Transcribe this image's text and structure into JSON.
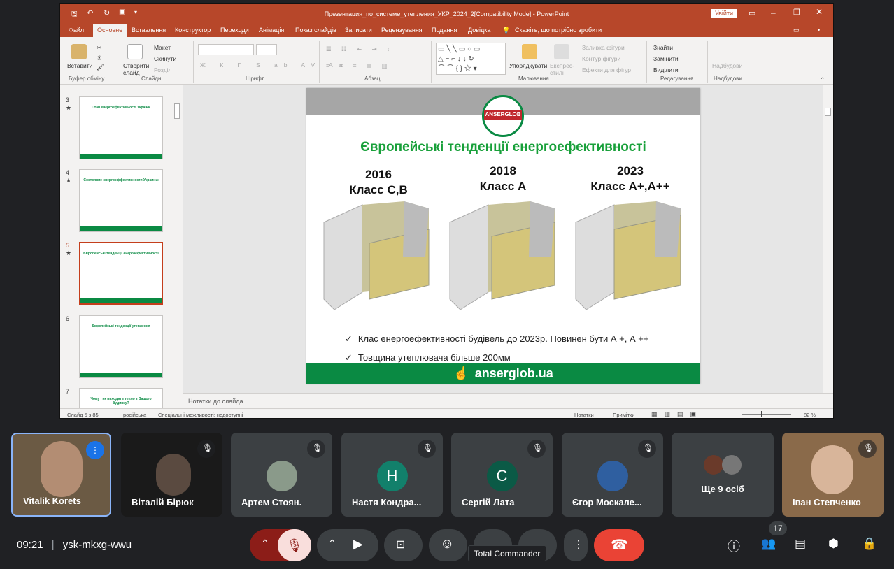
{
  "window": {
    "title": "Презентация_по_системе_утепления_УКР_2024_2[Compatibility Mode]  -  PowerPoint",
    "signin_label": "Увійти"
  },
  "ribbon_tabs": [
    "Файл",
    "Основне",
    "Вставлення",
    "Конструктор",
    "Переходи",
    "Анімація",
    "Показ слайдів",
    "Записати",
    "Рецензування",
    "Подання",
    "Довідка"
  ],
  "tell_me": "Скажіть, що потрібно зробити",
  "ribbon": {
    "paste": "Вставити",
    "clipboard": "Буфер обміну",
    "new_slide": "Створити слайд",
    "layout": "Макет",
    "reset": "Скинути",
    "section": "Розділ",
    "slides": "Слайди",
    "font": "Шрифт",
    "paragraph": "Абзац",
    "arrange": "Упорядкувати",
    "quick_styles": "Експрес-стилі",
    "shape_fill": "Заливка фігури",
    "shape_outline": "Контур фігури",
    "shape_effects": "Ефекти для фігур",
    "drawing": "Малювання",
    "find": "Знайти",
    "replace": "Замінити",
    "select": "Виділити",
    "editing": "Редагування",
    "addins": "Надбудови",
    "addins_group": "Надбудови",
    "font_buttons": [
      "Ж",
      "К",
      "П",
      "S",
      "ab",
      "AV",
      "Aa"
    ]
  },
  "thumbnails": [
    {
      "num": "3",
      "star": "★",
      "title": "Стан енергоефективності України"
    },
    {
      "num": "4",
      "star": "★",
      "title": "Состояние энергоэффективности Украины"
    },
    {
      "num": "5",
      "star": "★",
      "title": "Європейські тенденції енергоефективності"
    },
    {
      "num": "6",
      "star": "",
      "title": "Європейські тенденції утеплення"
    },
    {
      "num": "7",
      "star": "",
      "title": "Чому і як виходить тепло з Вашого будинку?"
    }
  ],
  "slide": {
    "logo": "ANSERGLOB",
    "title": "Європейські тенденції енергоефективності",
    "col1_year": "2016",
    "col1_class": "Класс С,В",
    "col2_year": "2018",
    "col2_class": "Класс А",
    "col3_year": "2023",
    "col3_class": "Класс А+,А++",
    "bullet1": "Клас енергоефективності будівель до 2023р. Повинен бути А +, А ++",
    "bullet2": "Товщина утеплювача більше 200мм",
    "check": "✓",
    "footer": "anserglob.ua"
  },
  "notes_placeholder": "Нотатки до слайда",
  "status": {
    "slide": "Слайд 5 з 85",
    "lang": "російська",
    "access": "Спеціальні можливості: недоступні",
    "notes": "Нотатки",
    "comments": "Примітки",
    "zoom": "82 %",
    "zoom_value": 82
  },
  "participants": [
    {
      "name": "Vitalik Korets",
      "kind": "video",
      "speaking": true
    },
    {
      "name": "Віталій Бірюк",
      "kind": "video"
    },
    {
      "name": "Артем Стоян.",
      "kind": "avatar-photo",
      "bg": "#8a9a8a"
    },
    {
      "name": "Настя Кондра...",
      "kind": "avatar",
      "letter": "Н",
      "bg": "#12806b"
    },
    {
      "name": "Сергій Лата",
      "kind": "avatar",
      "letter": "С",
      "bg": "#0b5a46"
    },
    {
      "name": "Єгор Москале...",
      "kind": "avatar-photo",
      "bg": "#2f5fa0"
    },
    {
      "name": "Ще 9 осіб",
      "kind": "group"
    },
    {
      "name": "Іван Степченко",
      "kind": "video"
    }
  ],
  "meeting": {
    "time": "09:21",
    "code": "ysk-mkxg-wwu",
    "participant_count": "17",
    "tooltip": "Total Commander"
  }
}
